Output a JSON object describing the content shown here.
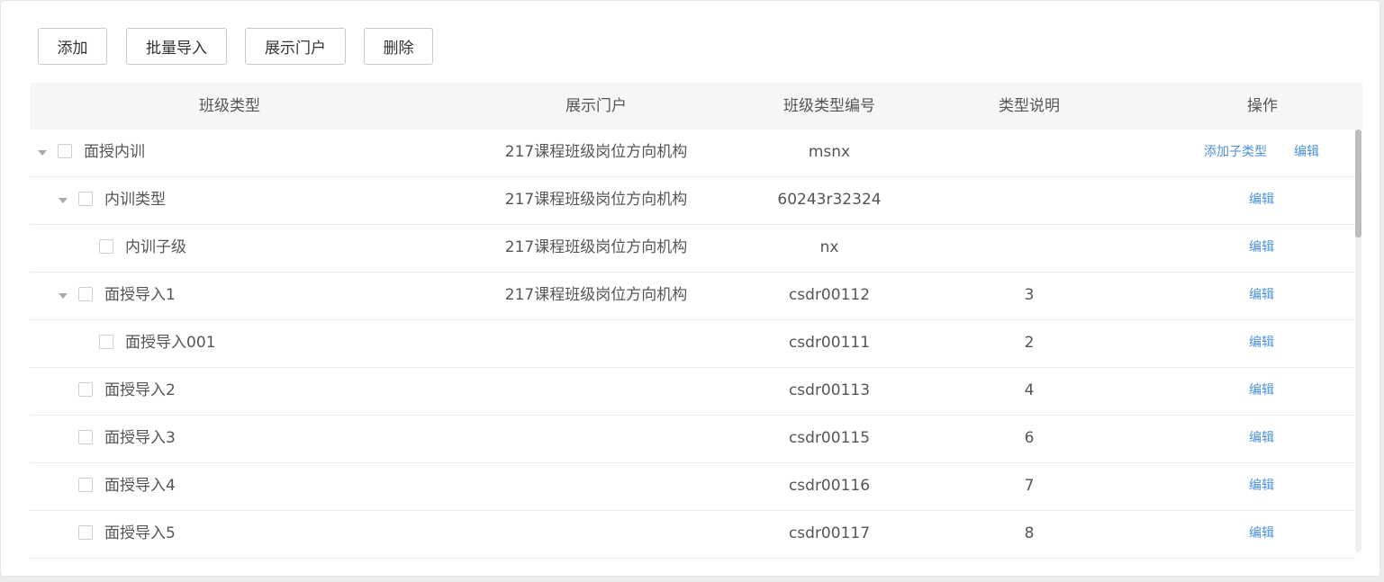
{
  "toolbar": {
    "add_label": "添加",
    "batch_import_label": "批量导入",
    "show_portal_label": "展示门户",
    "delete_label": "删除"
  },
  "table": {
    "headers": [
      "班级类型",
      "展示门户",
      "班级类型编号",
      "类型说明",
      "操作"
    ],
    "rows": [
      {
        "name": "面授内训",
        "portal": "217课程班级岗位方向机构",
        "code": "msnx",
        "desc": "",
        "actions": [
          "添加子类型",
          "编辑"
        ]
      },
      {
        "name": "内训类型",
        "portal": "217课程班级岗位方向机构",
        "code": "60243r32324",
        "desc": "",
        "actions": [
          "编辑"
        ]
      },
      {
        "name": "内训子级",
        "portal": "217课程班级岗位方向机构",
        "code": "nx",
        "desc": "",
        "actions": [
          "编辑"
        ]
      },
      {
        "name": "面授导入1",
        "portal": "217课程班级岗位方向机构",
        "code": "csdr00112",
        "desc": "3",
        "actions": [
          "编辑"
        ]
      },
      {
        "name": "面授导入001",
        "portal": "",
        "code": "csdr00111",
        "desc": "2",
        "actions": [
          "编辑"
        ]
      },
      {
        "name": "面授导入2",
        "portal": "",
        "code": "csdr00113",
        "desc": "4",
        "actions": [
          "编辑"
        ]
      },
      {
        "name": "面授导入3",
        "portal": "",
        "code": "csdr00115",
        "desc": "6",
        "actions": [
          "编辑"
        ]
      },
      {
        "name": "面授导入4",
        "portal": "",
        "code": "csdr00116",
        "desc": "7",
        "actions": [
          "编辑"
        ]
      },
      {
        "name": "面授导入5",
        "portal": "",
        "code": "csdr00117",
        "desc": "8",
        "actions": [
          "编辑"
        ]
      }
    ]
  },
  "colors": {
    "link": "#4a90d9",
    "header_bg": "#f5f6f7",
    "border": "#ececec"
  }
}
